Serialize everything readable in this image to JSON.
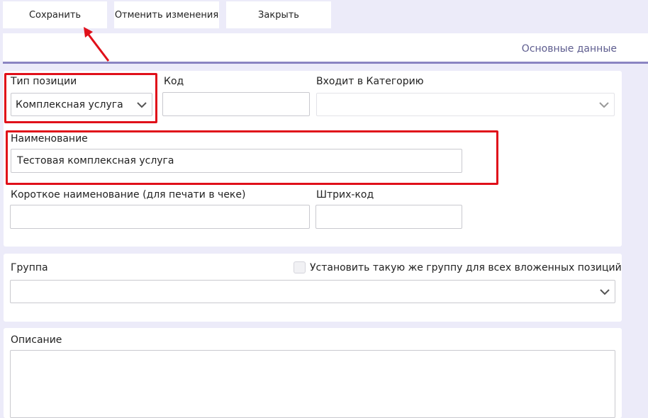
{
  "toolbar": {
    "save_label": "Сохранить",
    "cancel_label": "Отменить изменения",
    "close_label": "Закрыть"
  },
  "tabs": {
    "active_label": "Основные данные"
  },
  "main": {
    "position_type": {
      "label": "Тип позиции",
      "value": "Комплексная услуга"
    },
    "code": {
      "label": "Код",
      "value": ""
    },
    "category": {
      "label": "Входит в Категорию",
      "value": ""
    },
    "name": {
      "label": "Наименование",
      "value": "Тестовая комплексная услуга"
    },
    "short_name": {
      "label": "Короткое наименование (для печати в чеке)",
      "value": ""
    },
    "barcode": {
      "label": "Штрих-код",
      "value": ""
    }
  },
  "group_panel": {
    "group_label": "Группа",
    "group_value": "",
    "same_group_checkbox_label": "Установить такую же группу для всех вложенных позиций",
    "same_group_checked": false
  },
  "description_panel": {
    "label": "Описание",
    "value": ""
  },
  "colors": {
    "background": "#ecebf9",
    "accent_tab_underline": "#8b84c2",
    "annotation_red": "#e0101a"
  }
}
